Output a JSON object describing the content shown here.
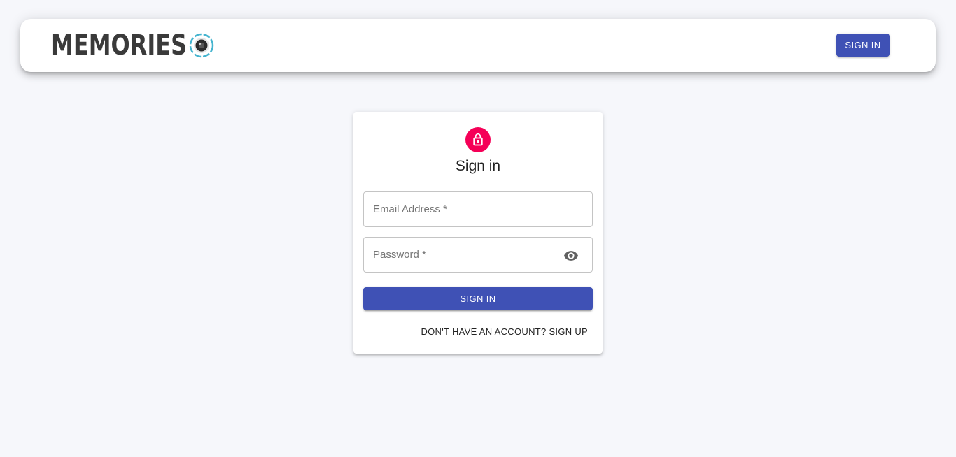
{
  "header": {
    "brand_text": "MEMORIES",
    "brand_icon": "camera-lens-icon",
    "signin_label": "SIGN IN",
    "accent_color": "#3f51b5"
  },
  "auth_card": {
    "avatar_icon": "lock-icon",
    "avatar_color": "#f50057",
    "title": "Sign in",
    "email": {
      "placeholder": "Email Address *",
      "value": ""
    },
    "password": {
      "placeholder": "Password *",
      "value": "",
      "toggle_icon": "eye-icon"
    },
    "submit_label": "SIGN IN",
    "switch_label": "DON'T HAVE AN ACCOUNT? SIGN UP"
  }
}
